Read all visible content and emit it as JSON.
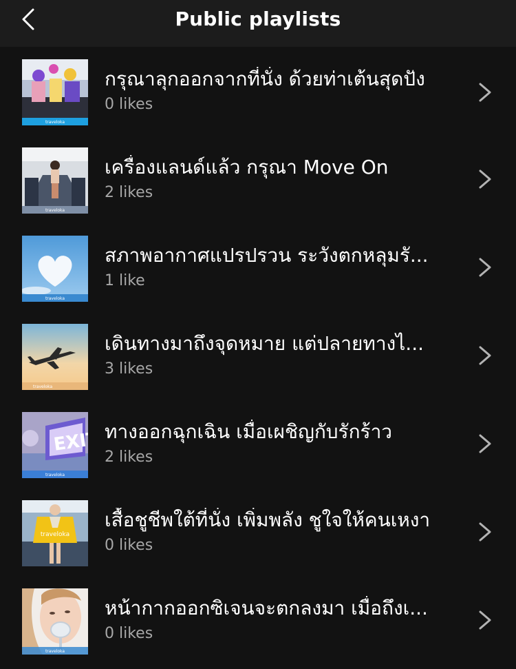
{
  "header": {
    "title": "Public playlists",
    "back_icon": "chevron-left-icon"
  },
  "brand": "traveloka",
  "playlists": [
    {
      "name": "กรุณาลุกออกจากที่นั่ง ด้วยท่าเต้นสุดปัง",
      "likes": "0 likes",
      "artwork": "dancing-crew-in-cabin"
    },
    {
      "name": "เครื่องแลนด์แล้ว กรุณา Move On",
      "likes": "2 likes",
      "artwork": "airplane-cabin-aisle"
    },
    {
      "name": "สภาพอากาศแปรปรวน ระวังตกหลุมรั...",
      "likes": "1 like",
      "artwork": "heart-cloud-sky"
    },
    {
      "name": "เดินทางมาถึงจุดหมาย แต่ปลายทางไ...",
      "likes": "3 likes",
      "artwork": "airplane-sunset-sky"
    },
    {
      "name": "ทางออกฉุกเฉิน เมื่อเผชิญกับรักร้าว",
      "likes": "2 likes",
      "artwork": "exit-sign"
    },
    {
      "name": "เสื้อชูชีพใต้ที่นั่ง เพิ่มพลัง ชูใจให้คนเหงา",
      "likes": "0 likes",
      "artwork": "life-vest"
    },
    {
      "name": "หน้ากากออกซิเจนจะตกลงมา เมื่อถึงเ...",
      "likes": "0 likes",
      "artwork": "oxygen-mask"
    }
  ],
  "colors": {
    "background": "#121212",
    "header": "#1c1c1c",
    "subtext": "#a7a7a7",
    "chevron": "#b3b3b3"
  }
}
